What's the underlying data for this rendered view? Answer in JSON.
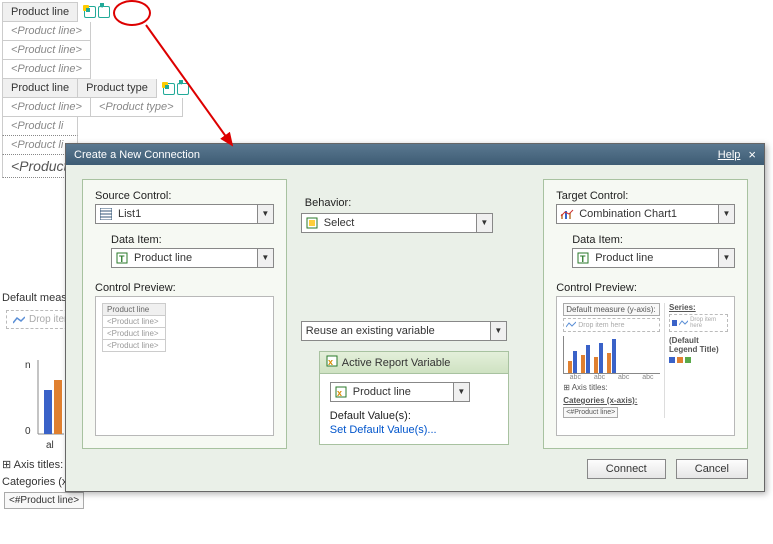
{
  "bg": {
    "headers": {
      "product_line": "Product line",
      "product_type": "Product type"
    },
    "ph": {
      "product_line": "<Product line>",
      "product_type": "<Product type>"
    },
    "row_summary": "<Product line summary>",
    "default_measure": "Default measure (y-axis):",
    "drop": "Drop item here",
    "axis_titles": "Axis titles:",
    "categories": "Categories (x-axis):",
    "cat_ph": "<#Product line>",
    "n": "n",
    "zero": "0",
    "al": "al"
  },
  "dialog": {
    "title": "Create a New Connection",
    "help": "Help",
    "source_label": "Source Control:",
    "source_value": "List1",
    "data_item_label": "Data Item:",
    "source_data_item": "Product line",
    "control_preview_label": "Control Preview:",
    "behavior_label": "Behavior:",
    "behavior_value": "Select",
    "reuse_value": "Reuse an existing variable",
    "arv": {
      "title": "Active Report Variable",
      "value": "Product line",
      "default_label": "Default Value(s):",
      "set_link": "Set Default Value(s)..."
    },
    "target_label": "Target Control:",
    "target_value": "Combination Chart1",
    "target_data_item": "Product line",
    "target_preview": {
      "default_measure": "Default measure (y-axis):",
      "drop": "Drop item here",
      "axis_titles": "Axis titles:",
      "categories": "Categories (x-axis):",
      "cat_ph": "<#Product line>",
      "series_label": "Series:",
      "legend": "(Default Legend Title)",
      "tick": "abc"
    },
    "buttons": {
      "connect": "Connect",
      "cancel": "Cancel"
    }
  },
  "chart_data": {
    "type": "bar",
    "categories": [
      "abc",
      "abc",
      "abc",
      "abc"
    ],
    "values_a": [
      12,
      22,
      18,
      28,
      16,
      30,
      20,
      34
    ],
    "colors": [
      "#e08030",
      "#3a62c8"
    ]
  },
  "preview_list": [
    "Product line",
    "<Product line>",
    "<Product line>",
    "<Product line>"
  ]
}
